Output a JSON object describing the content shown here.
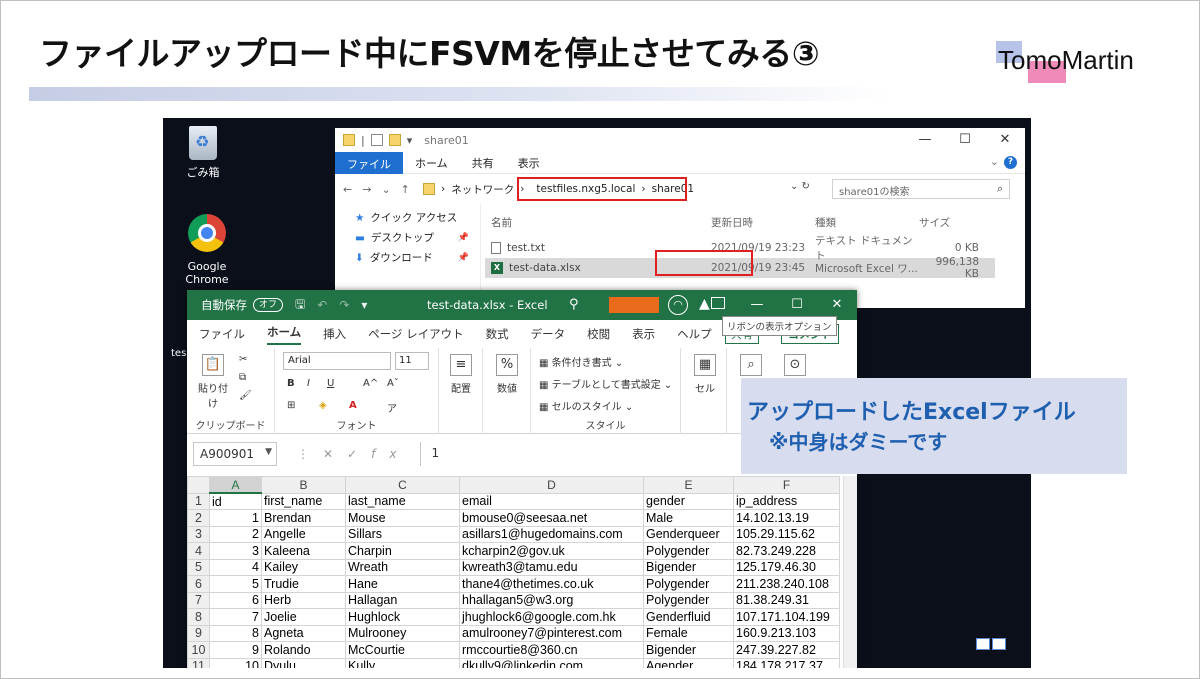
{
  "slide": {
    "title": "ファイルアップロード中にFSVMを停止させてみる③",
    "logo": "TomoMartin"
  },
  "desktop": {
    "icons": [
      {
        "label": "ごみ箱",
        "icon": "recycle-bin-icon"
      },
      {
        "label": "Google Chrome",
        "icon": "chrome-icon"
      },
      {
        "label": "tes",
        "icon": "file-icon"
      }
    ]
  },
  "explorer": {
    "window_title": "share01",
    "ribbon_tabs": [
      "ファイル",
      "ホーム",
      "共有",
      "表示"
    ],
    "address": {
      "network": "ネットワーク",
      "server": "testfiles.nxg5.local",
      "share": "share01"
    },
    "search_placeholder": "share01の検索",
    "nav": [
      {
        "label": "クイック アクセス"
      },
      {
        "label": "デスクトップ"
      },
      {
        "label": "ダウンロード"
      }
    ],
    "columns": [
      "名前",
      "更新日時",
      "種類",
      "サイズ"
    ],
    "files": [
      {
        "name": "test.txt",
        "date": "2021/09/19 23:23",
        "type": "テキスト ドキュメント",
        "size": "0 KB"
      },
      {
        "name": "test-data.xlsx",
        "date": "2021/09/19 23:45",
        "type": "Microsoft Excel ワ...",
        "size": "996,138 KB"
      }
    ]
  },
  "excel": {
    "autosave_label": "自動保存",
    "autosave_state": "オフ",
    "filename": "test-data.xlsx - Excel",
    "tooltip": "リボンの表示オプション",
    "tabs": [
      "ファイル",
      "ホーム",
      "挿入",
      "ページ レイアウト",
      "数式",
      "データ",
      "校閲",
      "表示",
      "ヘルプ"
    ],
    "share_label": "共有",
    "comment_label": "コメント",
    "ribbon": {
      "clipboard": {
        "paste": "貼り付け",
        "group": "クリップボード"
      },
      "font": {
        "name": "Arial",
        "size": "11",
        "group": "フォント"
      },
      "align": {
        "label": "配置"
      },
      "number": {
        "label": "数値"
      },
      "styles": {
        "cond": "条件付き書式",
        "table": "テーブルとして書式設定",
        "cell": "セルのスタイル",
        "group": "スタイル"
      },
      "cells": {
        "label": "セル"
      }
    },
    "name_box": "A900901",
    "formula": "1",
    "column_headers": [
      "A",
      "B",
      "C",
      "D",
      "E",
      "F"
    ],
    "rows": [
      [
        "id",
        "first_name",
        "last_name",
        "email",
        "gender",
        "ip_address"
      ],
      [
        "1",
        "Brendan",
        "Mouse",
        "bmouse0@seesaa.net",
        "Male",
        "14.102.13.19"
      ],
      [
        "2",
        "Angelle",
        "Sillars",
        "asillars1@hugedomains.com",
        "Genderqueer",
        "105.29.115.62"
      ],
      [
        "3",
        "Kaleena",
        "Charpin",
        "kcharpin2@gov.uk",
        "Polygender",
        "82.73.249.228"
      ],
      [
        "4",
        "Kailey",
        "Wreath",
        "kwreath3@tamu.edu",
        "Bigender",
        "125.179.46.30"
      ],
      [
        "5",
        "Trudie",
        "Hane",
        "thane4@thetimes.co.uk",
        "Polygender",
        "211.238.240.108"
      ],
      [
        "6",
        "Herb",
        "Hallagan",
        "hhallagan5@w3.org",
        "Polygender",
        "81.38.249.31"
      ],
      [
        "7",
        "Joelie",
        "Hughlock",
        "jhughlock6@google.com.hk",
        "Genderfluid",
        "107.171.104.199"
      ],
      [
        "8",
        "Agneta",
        "Mulrooney",
        "amulrooney7@pinterest.com",
        "Female",
        "160.9.213.103"
      ],
      [
        "9",
        "Rolando",
        "McCourtie",
        "rmccourtie8@360.cn",
        "Bigender",
        "247.39.227.82"
      ],
      [
        "10",
        "Dyulu",
        "Kully",
        "dkully9@linkedin.com",
        "Agender",
        "184.178.217.37"
      ]
    ]
  },
  "callout": {
    "line1": "アップロードしたExcelファイル",
    "line2": "※中身はダミーです"
  }
}
